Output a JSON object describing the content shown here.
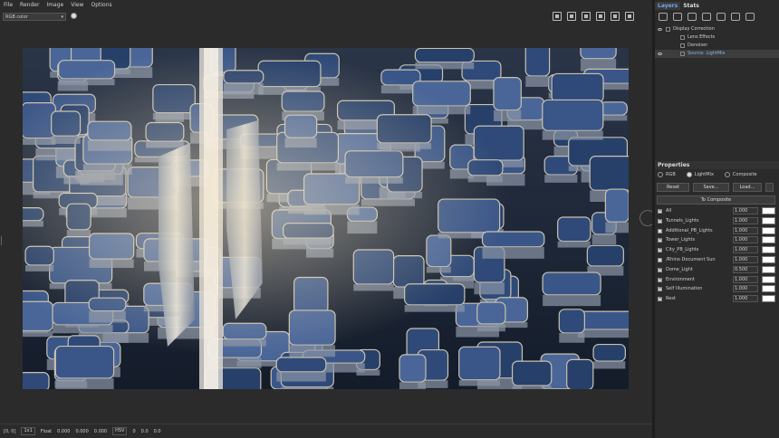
{
  "menu": [
    "File",
    "Render",
    "Image",
    "View",
    "Options"
  ],
  "toolbar": {
    "channel_select": "RGB color",
    "icons": [
      "save-icon",
      "save-all-icon",
      "region-icon",
      "fit-icon",
      "globe-icon",
      "settings-icon"
    ]
  },
  "status": {
    "coords": "[0, 0]",
    "zoom": "1x1",
    "r_value": "0.000",
    "g_value": "0.000",
    "b_value": "0.000",
    "color_mode": "HSV",
    "h_value": "0",
    "s_value": "0.0",
    "v_value": "0.0",
    "label_float": "Float"
  },
  "panel": {
    "tabs": [
      "Layers",
      "Stats"
    ],
    "tree": [
      {
        "label": "Display Correction",
        "indent": 18
      },
      {
        "label": "Lens Effects",
        "indent": 34
      },
      {
        "label": "Denoiser",
        "indent": 34
      },
      {
        "label": "Source: LightMix",
        "indent": 34,
        "selected": true
      }
    ],
    "properties_title": "Properties",
    "radio_rgb": "RGB",
    "radio_lightmix": "LightMix",
    "radio_composite": "Composite",
    "reset_label": "Reset",
    "save_label": "Save...",
    "load_label": "Load...",
    "to_composite_label": "To Composite",
    "lights": [
      {
        "name": "All",
        "value": "1.000",
        "checked": true
      },
      {
        "name": "Tunnels_Lights",
        "value": "1.000",
        "checked": true
      },
      {
        "name": "Additional_PB_Lights",
        "value": "1.000",
        "checked": false
      },
      {
        "name": "Tower_Lights",
        "value": "1.000",
        "checked": true
      },
      {
        "name": "City_PB_Lights",
        "value": "1.000",
        "checked": true
      },
      {
        "name": "/Rhino Document Sun",
        "value": "1.000",
        "checked": false
      },
      {
        "name": "Dome_Light",
        "value": "0.500",
        "checked": true
      },
      {
        "name": "Environment",
        "value": "1.000",
        "checked": true
      },
      {
        "name": "Self Illumination",
        "value": "1.000",
        "checked": true
      },
      {
        "name": "Rest",
        "value": "1.000",
        "checked": true
      }
    ]
  }
}
